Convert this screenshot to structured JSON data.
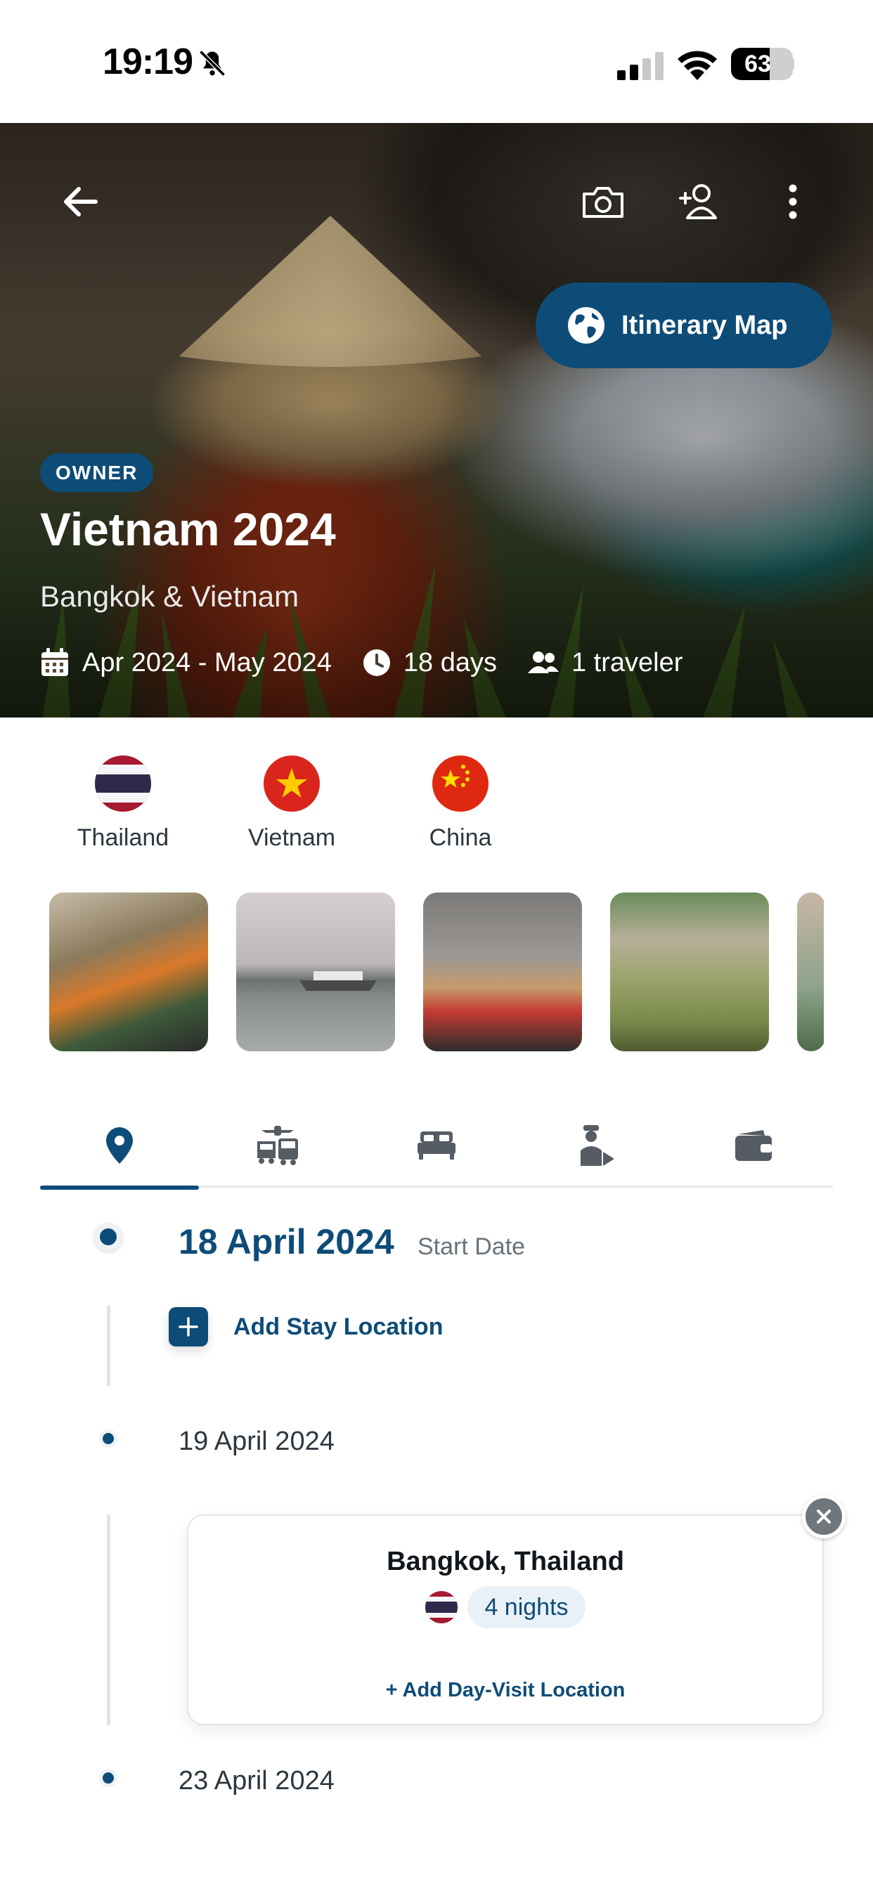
{
  "status_bar": {
    "time": "19:19",
    "battery": "63",
    "battery_level": 0.63
  },
  "hero": {
    "map_button_label": "Itinerary Map",
    "badge": "OWNER",
    "title": "Vietnam 2024",
    "subtitle": "Bangkok & Vietnam",
    "dates": "Apr 2024 - May 2024",
    "duration": "18 days",
    "travelers": "1 traveler"
  },
  "countries": [
    {
      "name": "Thailand",
      "flag": "thailand-flag"
    },
    {
      "name": "Vietnam",
      "flag": "vietnam-flag"
    },
    {
      "name": "China",
      "flag": "china-flag"
    }
  ],
  "tabs": [
    {
      "name": "locations",
      "icon": "map-pin-icon",
      "active": true
    },
    {
      "name": "transport",
      "icon": "transport-icon",
      "active": false
    },
    {
      "name": "stays",
      "icon": "bed-icon",
      "active": false
    },
    {
      "name": "guide",
      "icon": "guide-icon",
      "active": false
    },
    {
      "name": "wallet",
      "icon": "wallet-icon",
      "active": false
    }
  ],
  "timeline": {
    "start_date": "18 April 2024",
    "start_note": "Start Date",
    "add_stay_label": "Add Stay Location",
    "date_2": "19 April 2024",
    "stay": {
      "city": "Bangkok, Thailand",
      "nights": "4 nights",
      "add_day_visit": "+ Add Day-Visit Location"
    },
    "date_3": "23 April 2024"
  },
  "colors": {
    "primary": "#0e4c78",
    "pill_bg": "#e9f1f8",
    "divider": "#e1e4e7"
  }
}
